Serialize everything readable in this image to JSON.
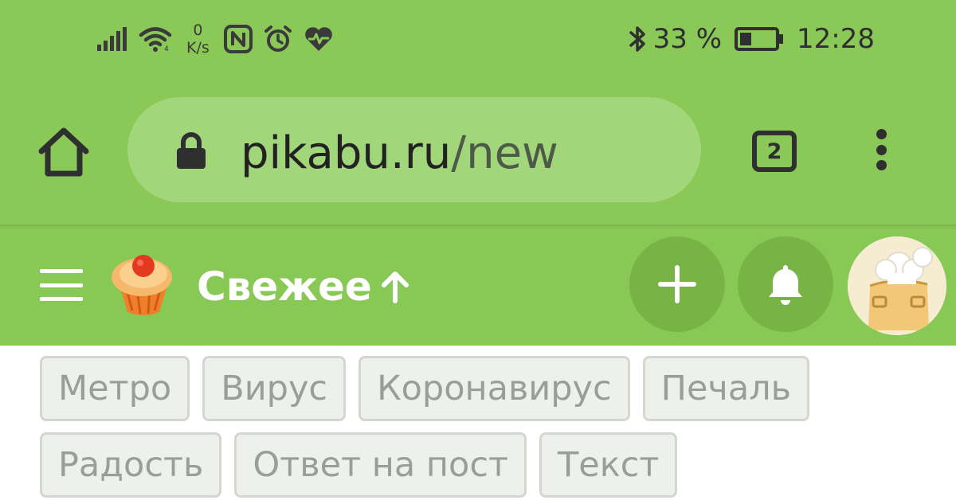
{
  "status_bar": {
    "speed_value": "0",
    "speed_unit": "K/s",
    "battery_percent": "33 %",
    "battery_level": 0.33,
    "time": "12:28",
    "icons": [
      "signal-icon",
      "wifi-icon",
      "nfc-icon",
      "alarm-icon",
      "health-heart-icon",
      "bluetooth-icon",
      "battery-icon"
    ]
  },
  "browser": {
    "url_host": "pikabu.ru",
    "url_path": "/new",
    "tab_count": "2",
    "icons": [
      "home-icon",
      "lock-icon",
      "tabs-icon",
      "more-vert-icon"
    ]
  },
  "app_header": {
    "title": "Свежее",
    "icons": [
      "hamburger-menu-icon",
      "cupcake-logo-icon",
      "arrow-up-icon",
      "plus-icon",
      "bell-icon",
      "avatar-chef-icon"
    ]
  },
  "tags": {
    "row1": [
      "Метро",
      "Вирус",
      "Коронавирус",
      "Печаль"
    ],
    "row2": [
      "Радость",
      "Ответ на пост",
      "Текст"
    ]
  },
  "colors": {
    "browser_bar": "#8ac858",
    "url_pill": "#a2d67b",
    "app_bar": "#88c855",
    "round_button": "#78b346",
    "tag_bg": "#eef0ec",
    "tag_text": "#9a9d98"
  }
}
